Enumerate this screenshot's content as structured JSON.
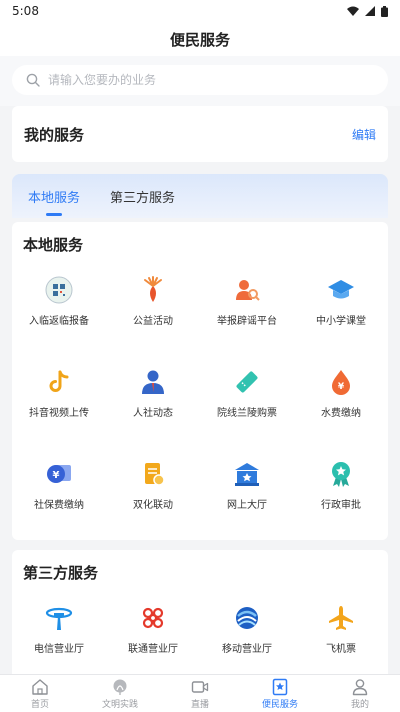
{
  "status_bar": {
    "time": "5:08"
  },
  "header": {
    "title": "便民服务"
  },
  "search": {
    "placeholder": "请输入您要办的业务"
  },
  "my_services": {
    "title": "我的服务",
    "edit_label": "编辑"
  },
  "tabs": [
    {
      "label": "本地服务",
      "active": true
    },
    {
      "label": "第三方服务",
      "active": false
    }
  ],
  "local_section": {
    "title": "本地服务",
    "items": [
      {
        "label": "入临返临报备",
        "icon": "qr-code-icon"
      },
      {
        "label": "公益活动",
        "icon": "charity-icon"
      },
      {
        "label": "举报辟谣平台",
        "icon": "report-icon"
      },
      {
        "label": "中小学课堂",
        "icon": "graduation-cap-icon"
      },
      {
        "label": "抖音视频上传",
        "icon": "tiktok-icon"
      },
      {
        "label": "人社动态",
        "icon": "person-icon"
      },
      {
        "label": "院线兰陵购票",
        "icon": "ticket-icon"
      },
      {
        "label": "水费缴纳",
        "icon": "water-drop-icon"
      },
      {
        "label": "社保费缴纳",
        "icon": "social-security-icon"
      },
      {
        "label": "双化联动",
        "icon": "document-icon"
      },
      {
        "label": "网上大厅",
        "icon": "hall-icon"
      },
      {
        "label": "行政审批",
        "icon": "approval-badge-icon"
      }
    ]
  },
  "third_section": {
    "title": "第三方服务",
    "items": [
      {
        "label": "电信营业厅",
        "icon": "telecom-icon"
      },
      {
        "label": "联通营业厅",
        "icon": "unicom-icon"
      },
      {
        "label": "移动营业厅",
        "icon": "mobile-icon"
      },
      {
        "label": "飞机票",
        "icon": "airplane-icon"
      }
    ]
  },
  "bottom_nav": [
    {
      "label": "首页",
      "icon": "home-icon",
      "active": false
    },
    {
      "label": "文明实践",
      "icon": "civilization-icon",
      "active": false
    },
    {
      "label": "直播",
      "icon": "live-video-icon",
      "active": false
    },
    {
      "label": "便民服务",
      "icon": "service-bookmark-icon",
      "active": true
    },
    {
      "label": "我的",
      "icon": "profile-icon",
      "active": false
    }
  ],
  "colors": {
    "accent": "#2f7bf5",
    "background": "#f3f4f6"
  }
}
